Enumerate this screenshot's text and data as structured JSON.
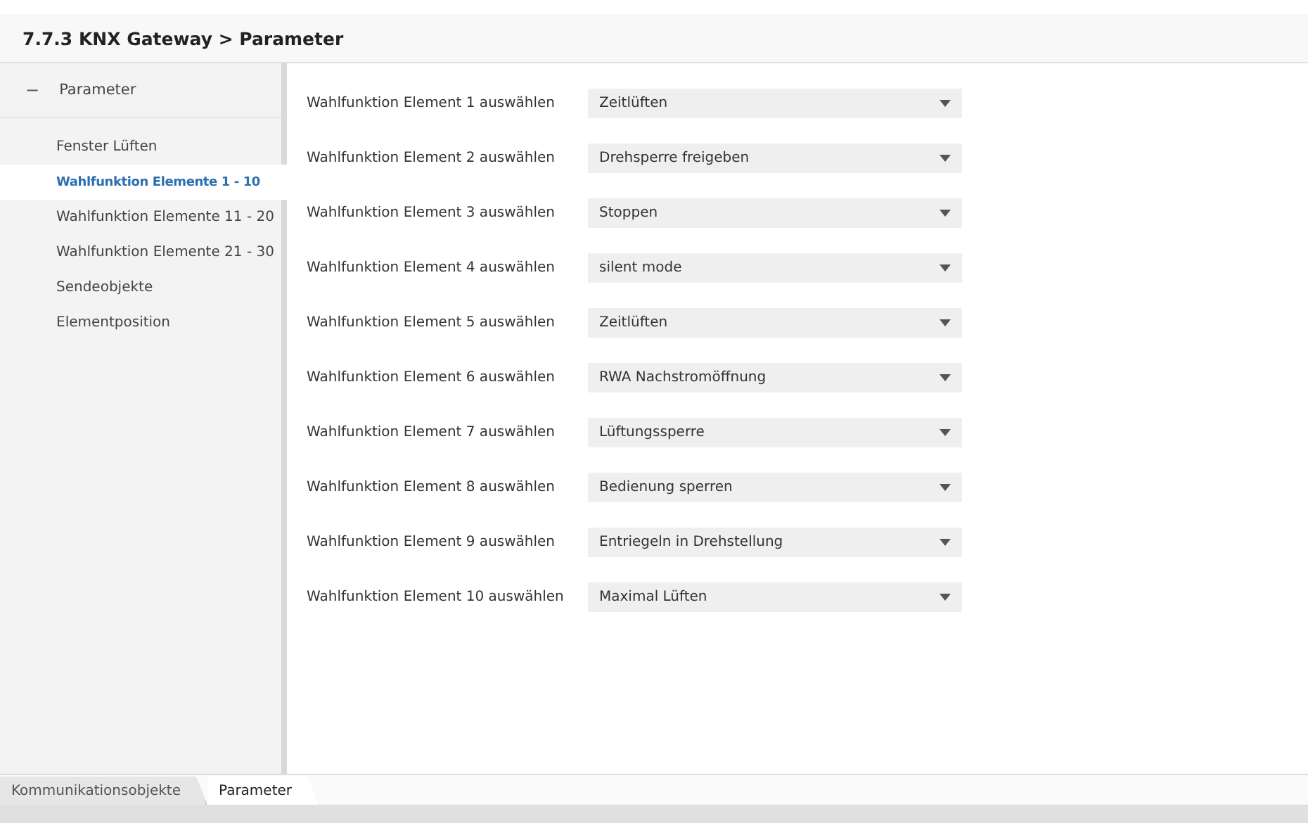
{
  "header": {
    "title": "7.7.3 KNX Gateway > Parameter"
  },
  "sidebar": {
    "group": {
      "label": "Parameter",
      "expanded": true,
      "toggle": "−"
    },
    "items": [
      {
        "label": "Fenster Lüften",
        "selected": false
      },
      {
        "label": "Wahlfunktion Elemente 1 - 10",
        "selected": true
      },
      {
        "label": "Wahlfunktion Elemente 11 - 20",
        "selected": false
      },
      {
        "label": "Wahlfunktion Elemente 21 - 30",
        "selected": false
      },
      {
        "label": "Sendeobjekte",
        "selected": false
      },
      {
        "label": "Elementposition",
        "selected": false
      }
    ]
  },
  "parameters": [
    {
      "label": "Wahlfunktion Element 1 auswählen",
      "value": "Zeitlüften"
    },
    {
      "label": "Wahlfunktion Element 2 auswählen",
      "value": "Drehsperre freigeben"
    },
    {
      "label": "Wahlfunktion Element 3 auswählen",
      "value": "Stoppen"
    },
    {
      "label": "Wahlfunktion Element 4 auswählen",
      "value": "silent mode"
    },
    {
      "label": "Wahlfunktion Element 5 auswählen",
      "value": "Zeitlüften"
    },
    {
      "label": "Wahlfunktion Element 6 auswählen",
      "value": "RWA Nachstromöffnung"
    },
    {
      "label": "Wahlfunktion Element 7 auswählen",
      "value": "Lüftungssperre"
    },
    {
      "label": "Wahlfunktion Element 8 auswählen",
      "value": "Bedienung sperren"
    },
    {
      "label": "Wahlfunktion Element 9 auswählen",
      "value": "Entriegeln in Drehstellung"
    },
    {
      "label": "Wahlfunktion Element 10 auswählen",
      "value": "Maximal Lüften"
    }
  ],
  "bottom_tabs": [
    {
      "label": "Kommunikationsobjekte",
      "selected": false
    },
    {
      "label": "Parameter",
      "selected": true
    }
  ]
}
